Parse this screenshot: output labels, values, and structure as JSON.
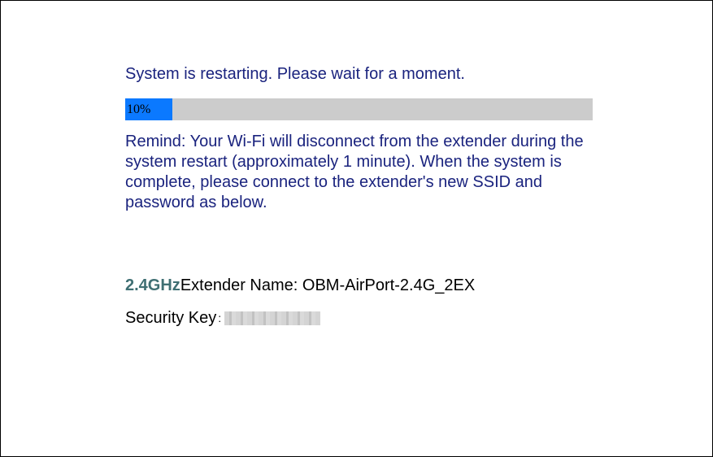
{
  "restart": {
    "message": "System is restarting. Please wait for a moment.",
    "progress_label": "10%",
    "progress_fraction": 0.1,
    "remind": "Remind: Your Wi-Fi will disconnect from the extender during the system restart (approximately 1 minute). When the system is complete, please connect to the extender's new SSID and password as below."
  },
  "network": {
    "band": "2.4GHz",
    "name_label": "Extender Name: ",
    "name_value": "OBM-AirPort-2.4G_2EX",
    "key_label": "Security Key",
    "key_separator": ":"
  },
  "colors": {
    "message_text": "#1a237e",
    "progress_fill": "#0b79ff",
    "progress_track": "#cccccc",
    "band_text": "#3f6f73"
  }
}
